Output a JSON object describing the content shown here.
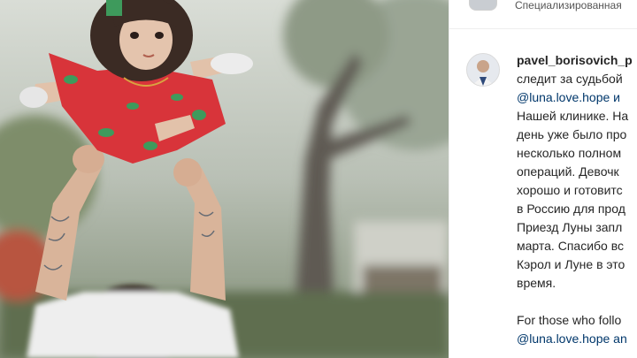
{
  "post": {
    "photo_alt": "Photo",
    "colors": {
      "link": "#00376b",
      "text": "#262626",
      "dress_red": "#d8343a",
      "dress_green": "#3e9a5c"
    }
  },
  "header": {
    "text": "Специализированная"
  },
  "caption": {
    "username": "pavel_borisovich_p",
    "lines_ru": [
      "следит за судьбой",
      "@luna.love.hope и",
      "Нашей клинике. На",
      "день уже было про",
      "несколько полном",
      "операций. Девочк",
      "хорошо и готовитс",
      "в Россию для прод",
      "Приезд Луны запл",
      "марта. Спасибо вс",
      "Кэрол и Луне в это",
      "время."
    ],
    "lines_en": [
      "For those who follo",
      "@luna.love.hope an"
    ]
  }
}
